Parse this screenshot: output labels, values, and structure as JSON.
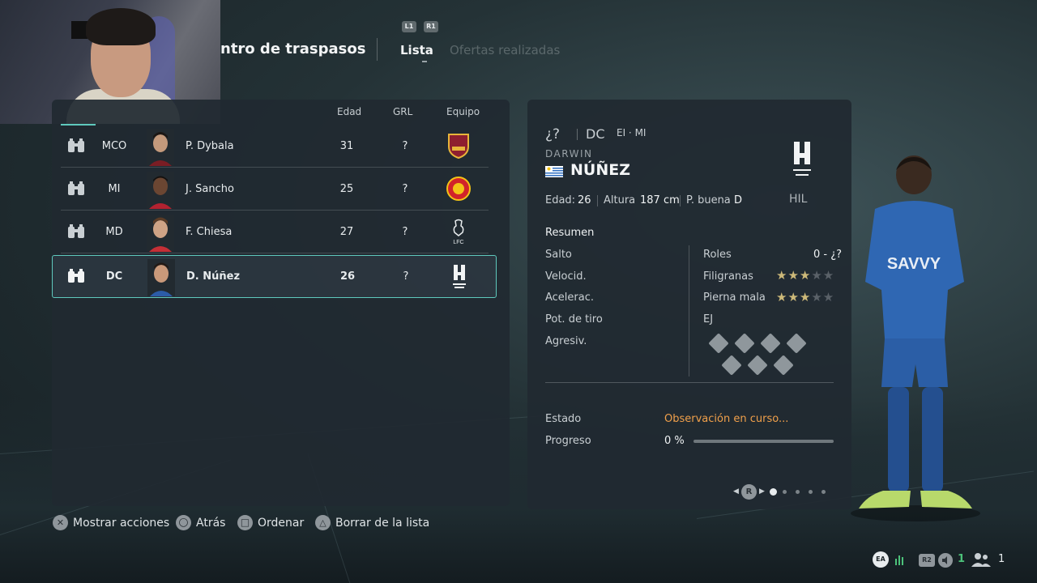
{
  "header": {
    "title": "ntro de traspasos",
    "bumper_left": "L1",
    "bumper_right": "R1",
    "tabs": [
      {
        "label": "Lista",
        "active": true
      },
      {
        "label": "Ofertas realizadas",
        "active": false
      }
    ]
  },
  "list": {
    "columns": {
      "age": "Edad",
      "grl": "GRL",
      "team": "Equipo"
    },
    "rows": [
      {
        "position": "MCO",
        "name": "P. Dybala",
        "age": "31",
        "grl": "?",
        "crest": "roma-crest-icon",
        "selected": false
      },
      {
        "position": "MI",
        "name": "J. Sancho",
        "age": "25",
        "grl": "?",
        "crest": "manutd-crest-icon",
        "selected": false
      },
      {
        "position": "MD",
        "name": "F. Chiesa",
        "age": "27",
        "grl": "?",
        "crest": "liverpool-crest-icon",
        "selected": false
      },
      {
        "position": "DC",
        "name": "D. Núñez",
        "age": "26",
        "grl": "?",
        "crest": "alhilal-crest-icon",
        "selected": true
      }
    ]
  },
  "detail": {
    "overall": "¿?",
    "main_position": "DC",
    "alt_positions": "EI · MI",
    "first_name": "DARWIN",
    "last_name": "NÚÑEZ",
    "nationality_flag": "uruguay-flag-icon",
    "club_code": "HIL",
    "age_label": "Edad:",
    "age_value": "26",
    "height_label": "Altura",
    "height_value": "187 cm",
    "foot_label": "P. buena",
    "foot_value": "D",
    "summary_title": "Resumen",
    "attributes": [
      "Salto",
      "Velocid.",
      "Aceleraс.",
      "Pot. de tiro",
      "Agresiv."
    ],
    "roles_label": "Roles",
    "roles_value": "0 - ¿?",
    "skill_moves_label": "Filigranas",
    "skill_moves_stars": 3,
    "weak_foot_label": "Pierna mala",
    "weak_foot_stars": 3,
    "playstyles_label": "EJ",
    "status_label": "Estado",
    "status_value": "Observación en curso...",
    "progress_label": "Progreso",
    "progress_value": "0 %",
    "progress_fraction": 0,
    "pager_button": "R",
    "pager_count": 5,
    "pager_active": 0,
    "accent_color": "#5fc9bd",
    "status_color": "#f0a04b"
  },
  "hints": [
    {
      "glyph": "cross",
      "label": "Mostrar acciones"
    },
    {
      "glyph": "circle",
      "label": "Atrás"
    },
    {
      "glyph": "square",
      "label": "Ordenar"
    },
    {
      "glyph": "triangle",
      "label": "Borrar de la lista"
    }
  ],
  "status_bar": {
    "r2_label": "R2",
    "count_green": "1",
    "count_users": "1"
  }
}
